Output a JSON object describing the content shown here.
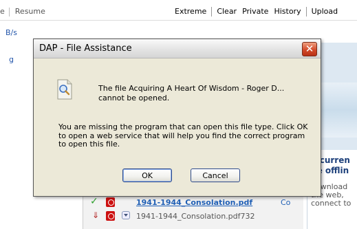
{
  "toolbar": {
    "left_label_1": "e",
    "left_label_2": "Resume",
    "extreme": "Extreme",
    "clear": "Clear",
    "private": "Private",
    "history": "History",
    "upload": "Upload"
  },
  "side": {
    "rate": "B/s",
    "fragment": "g"
  },
  "offline_panel": {
    "title_line1": "u curren",
    "title_line2": "be offlin",
    "text_line1": "download",
    "text_line2": "the web,",
    "text_line3": "connect to"
  },
  "downloads": {
    "row1_title": "1941-1944_Consolation.pdf",
    "row1_col": "Co",
    "row2_file": "1941-1944_Consolation.pdf732"
  },
  "dialog": {
    "title": "DAP - File Assistance",
    "message1": "The file Acquiring A Heart Of Wisdom - Roger D... cannot be opened.",
    "message2": "You are missing the program that can open this file type. Click OK to open a web service that will help you find the correct program to open this file.",
    "ok_label": "OK",
    "cancel_label": "Cancel",
    "close_glyph": "✕"
  },
  "icons": {
    "close": "close-icon",
    "file": "file-search-icon",
    "check": "check-icon",
    "pdf": "pdf-icon"
  },
  "colors": {
    "dialog_bg": "#ece9d8",
    "link_blue": "#1f5fb5",
    "close_red": "#d24a2a",
    "check_green": "#2ea02e"
  }
}
